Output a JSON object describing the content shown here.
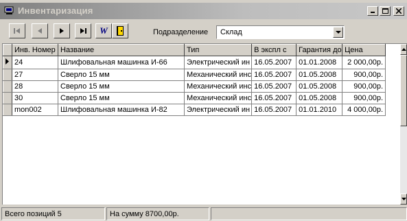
{
  "window": {
    "title": "Инвентаризация"
  },
  "toolbar": {
    "nav": [
      "first-icon",
      "prior-icon",
      "next-icon",
      "last-icon",
      "word-icon",
      "exit-icon"
    ],
    "word_glyph": "W",
    "department_label": "Подразделение",
    "department_value": "Склад"
  },
  "grid": {
    "columns": [
      "Инв. Номер",
      "Название",
      "Тип",
      "В экспл с",
      "Гарантия до",
      "Цена"
    ],
    "rows": [
      [
        "24",
        "Шлифовальная машинка И-66",
        "Электрический ин",
        "16.05.2007",
        "01.01.2008",
        "2 000,00р."
      ],
      [
        "27",
        "Сверло 15 мм",
        "Механический инс",
        "16.05.2007",
        "01.05.2008",
        "900,00р."
      ],
      [
        "28",
        "Сверло 15 мм",
        "Механический инс",
        "16.05.2007",
        "01.05.2008",
        "900,00р."
      ],
      [
        "30",
        "Сверло 15 мм",
        "Механический инс",
        "16.05.2007",
        "01.05.2008",
        "900,00р."
      ],
      [
        "mon002",
        "Шлифовальная машинка И-82",
        "Электрический ин",
        "16.05.2007",
        "01.01.2010",
        "4 000,00р."
      ]
    ],
    "current_row": 0
  },
  "status": {
    "total_positions": "Всего позиций 5",
    "total_sum": "На сумму 8700,00р."
  }
}
